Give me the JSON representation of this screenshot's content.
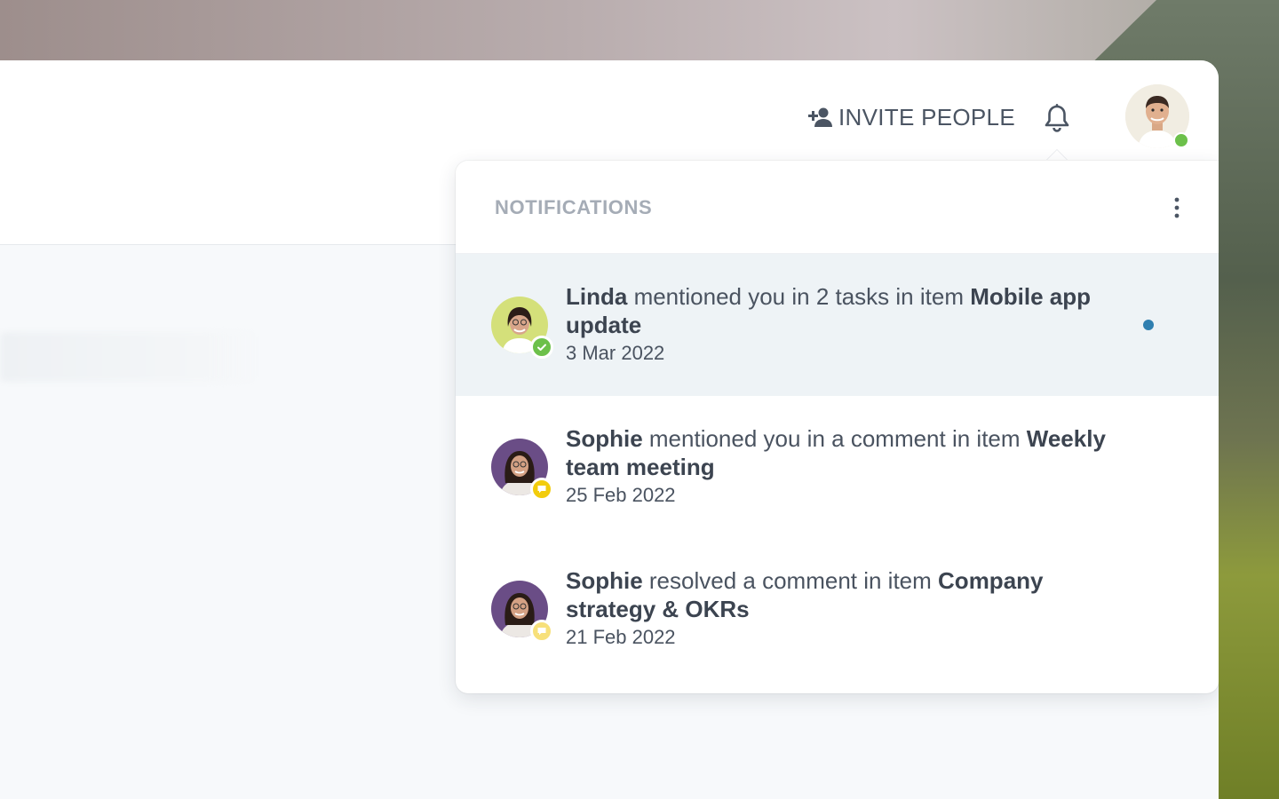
{
  "header": {
    "invite_label": "INVITE PEOPLE",
    "icons": {
      "invite": "add-person-icon",
      "notifications": "bell-icon",
      "status": "online-status-dot"
    },
    "status_color": "#6cc04a"
  },
  "notifications": {
    "title": "NOTIFICATIONS",
    "more_icon": "kebab-menu-icon",
    "items": [
      {
        "actor": "Linda",
        "action": " mentioned you in 2 tasks in item ",
        "target": "Mobile app update",
        "date": "3 Mar 2022",
        "badge_icon": "check-icon",
        "badge_color": "#6cc04a",
        "unread": true
      },
      {
        "actor": "Sophie",
        "action": " mentioned you in a comment in item ",
        "target": "Weekly team meeting",
        "date": "25 Feb 2022",
        "badge_icon": "comment-icon",
        "badge_color": "#f2cc0c",
        "unread": false
      },
      {
        "actor": "Sophie",
        "action": " resolved a comment in item ",
        "target": "Company strategy & OKRs",
        "date": "21 Feb 2022",
        "badge_icon": "comment-icon",
        "badge_color": "#f7e07a",
        "unread": false
      }
    ],
    "unread_color": "#2f7fb0"
  }
}
